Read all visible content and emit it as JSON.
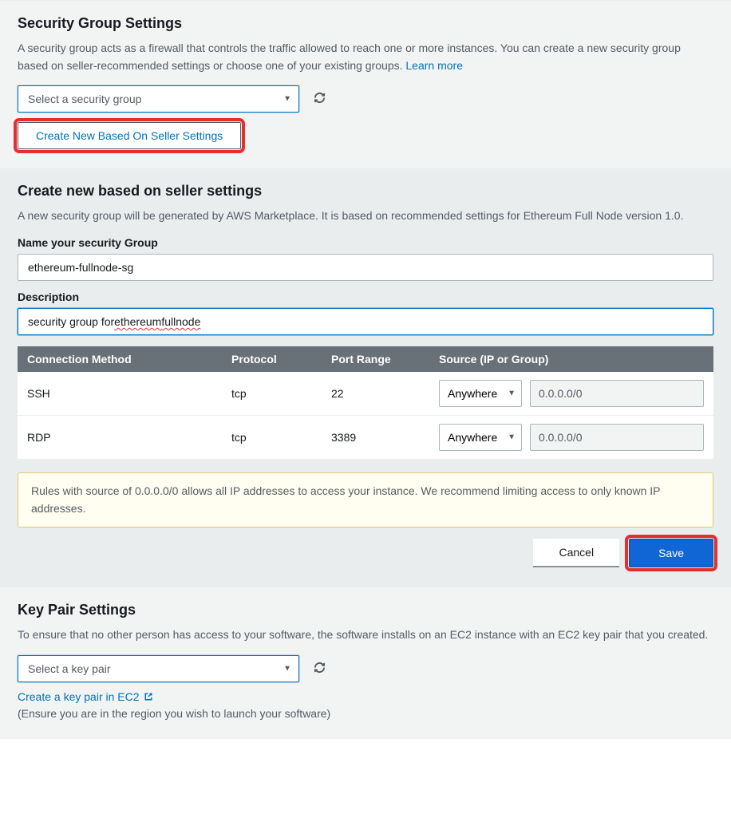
{
  "securityGroup": {
    "title": "Security Group Settings",
    "descPrefix": "A security group acts as a firewall that controls the traffic allowed to reach one or more instances. You can create a new security group based on seller-recommended settings or choose one of your existing groups. ",
    "learnMore": "Learn more",
    "selectPlaceholder": "Select a security group",
    "createButton": "Create New Based On Seller Settings"
  },
  "createNew": {
    "title": "Create new based on seller settings",
    "desc": "A new security group will be generated by AWS Marketplace. It is based on recommended settings for Ethereum Full Node version 1.0.",
    "nameLabel": "Name your security Group",
    "nameValue": "ethereum-fullnode-sg",
    "descLabel": "Description",
    "descValuePlain": "security group for ethereum fullnode",
    "descParts": {
      "p1": "security group for ",
      "w1": "ethereum",
      "sp": " ",
      "w2": "fullnode"
    },
    "headers": {
      "method": "Connection Method",
      "protocol": "Protocol",
      "port": "Port Range",
      "source": "Source (IP or Group)"
    },
    "rows": [
      {
        "method": "SSH",
        "protocol": "tcp",
        "port": "22",
        "sourceType": "Anywhere",
        "sourceCidr": "0.0.0.0/0"
      },
      {
        "method": "RDP",
        "protocol": "tcp",
        "port": "3389",
        "sourceType": "Anywhere",
        "sourceCidr": "0.0.0.0/0"
      }
    ],
    "warning": "Rules with source of 0.0.0.0/0 allows all IP addresses to access your instance. We recommend limiting access to only known IP addresses.",
    "cancel": "Cancel",
    "save": "Save"
  },
  "keyPair": {
    "title": "Key Pair Settings",
    "desc": "To ensure that no other person has access to your software, the software installs on an EC2 instance with an EC2 key pair that you created.",
    "selectPlaceholder": "Select a key pair",
    "createLink": "Create a key pair in EC2",
    "note": "(Ensure you are in the region you wish to launch your software)"
  }
}
